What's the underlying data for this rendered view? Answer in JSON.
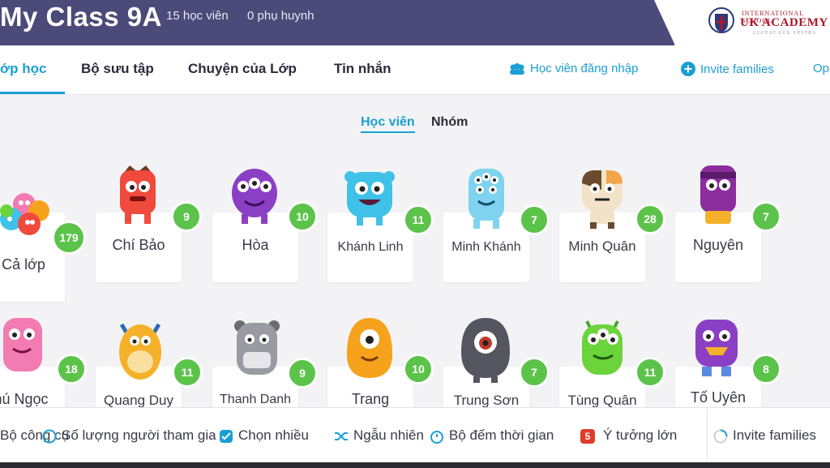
{
  "header": {
    "class_title": "My Class 9A",
    "students_count": "15 học viên",
    "parents_count": "0 phụ huynh",
    "logo": {
      "small": "INTERNATIONAL SCHOOL",
      "big": "UK ACADEMY",
      "motto": "LUCEAT LUX VESTRA"
    }
  },
  "nav": {
    "tabs": [
      "ớp học",
      "Bộ sưu tập",
      "Chuyện của Lớp",
      "Tin nhắn"
    ],
    "student_login": "Học viên đăng nhập",
    "invite_families": "Invite families",
    "options_cut": "Op"
  },
  "toggle": {
    "students": "Học viên",
    "groups": "Nhóm"
  },
  "whole_class": {
    "name": "Cả lớp",
    "points": "179"
  },
  "students_row1": [
    {
      "name": "Chí Bảo",
      "points": "9",
      "color": "#ef4a3c"
    },
    {
      "name": "Hòa",
      "points": "10",
      "color": "#8b3fc4"
    },
    {
      "name": "Khánh Linh",
      "points": "11",
      "color": "#3fc1e8"
    },
    {
      "name": "Minh Khánh",
      "points": "7",
      "color": "#7fd3ee"
    },
    {
      "name": "Minh Quân",
      "points": "28",
      "color": "#6b4a2e"
    },
    {
      "name": "Nguyên",
      "points": "7",
      "color": "#8c2d9e"
    }
  ],
  "students_row2": [
    {
      "name": "hú Ngọc",
      "points": "18",
      "color": "#f27bb2"
    },
    {
      "name": "Quang Duy",
      "points": "11",
      "color": "#f5b12a"
    },
    {
      "name": "Thanh Danh",
      "points": "9",
      "color": "#9a9aa2"
    },
    {
      "name": "Trang",
      "points": "10",
      "color": "#f7a21c"
    },
    {
      "name": "Trung Sơn",
      "points": "7",
      "color": "#555560"
    },
    {
      "name": "Tùng Quân",
      "points": "11",
      "color": "#6bd43a"
    },
    {
      "name": "Tố Uyên",
      "points": "8",
      "color": "#8b3fc4"
    }
  ],
  "toolbar": {
    "tools": "Bộ công cụ",
    "participants": "Số lượng người tham gia",
    "multi_select": "Chọn nhiều",
    "random": "Ngẫu nhiên",
    "timer": "Bộ đếm thời gian",
    "big_ideas": "Ý tưởng lớn",
    "big_ideas_badge": "5",
    "invite_families": "Invite families"
  },
  "colors": {
    "accent": "#1a9fd3",
    "header": "#4b4a78",
    "badge": "#5cc34a"
  }
}
